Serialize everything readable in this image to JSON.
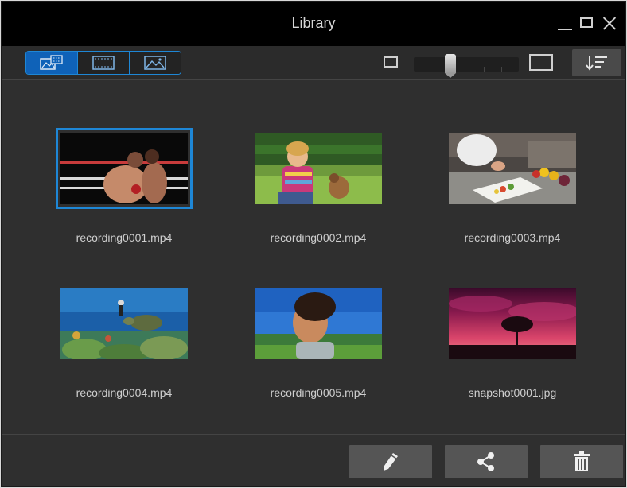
{
  "window": {
    "title": "Library",
    "controls": [
      "minimize-icon",
      "maximize-icon",
      "close-icon"
    ]
  },
  "toolbar": {
    "view_modes": [
      {
        "name": "all-media",
        "icon": "media-thumbnails-icon",
        "active": true
      },
      {
        "name": "video",
        "icon": "film-strip-icon",
        "active": false
      },
      {
        "name": "photo",
        "icon": "image-icon",
        "active": false
      }
    ],
    "thumbnail_size_slider": {
      "level": 0.33
    },
    "sort_icon": "sort-descending-icon"
  },
  "items": [
    {
      "filename": "recording0001.mp4",
      "type": "video",
      "selected": true
    },
    {
      "filename": "recording0002.mp4",
      "type": "video",
      "selected": false
    },
    {
      "filename": "recording0003.mp4",
      "type": "video",
      "selected": false
    },
    {
      "filename": "recording0004.mp4",
      "type": "video",
      "selected": false
    },
    {
      "filename": "recording0005.mp4",
      "type": "video",
      "selected": false
    },
    {
      "filename": "snapshot0001.jpg",
      "type": "image",
      "selected": false
    }
  ],
  "actions": [
    {
      "name": "edit",
      "icon": "pencil-icon"
    },
    {
      "name": "share",
      "icon": "share-icon"
    },
    {
      "name": "delete",
      "icon": "trash-icon"
    }
  ],
  "colors": {
    "accent": "#1e87d6",
    "window_bg": "#2f2f2f",
    "titlebar_bg": "#000000",
    "text": "#cfcfcf"
  }
}
